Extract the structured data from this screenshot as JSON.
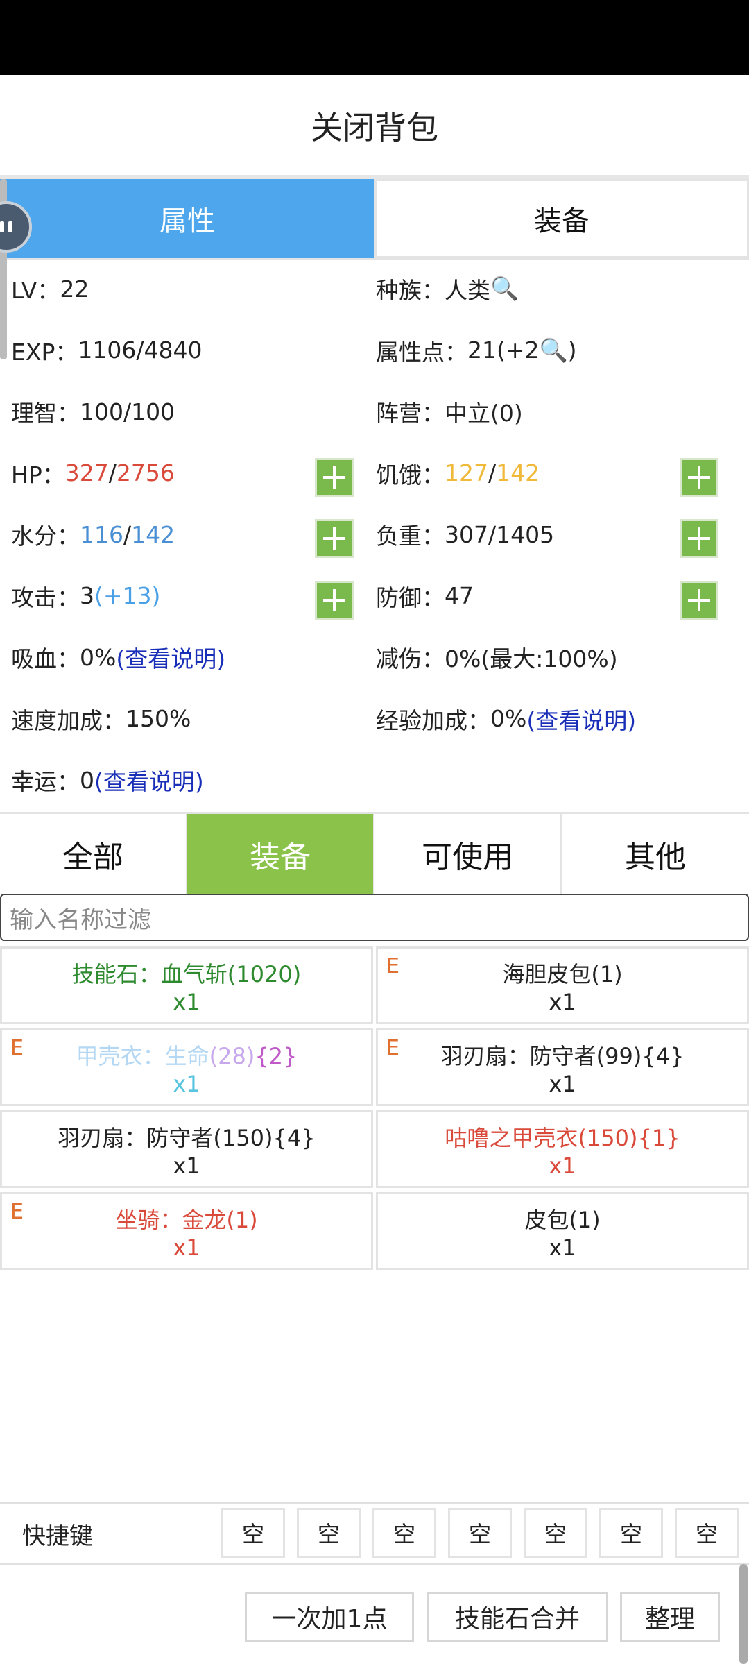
{
  "header": {
    "title": "关闭背包"
  },
  "main_tabs": [
    {
      "label": "属性",
      "active": true
    },
    {
      "label": "装备",
      "active": false
    }
  ],
  "attrs": {
    "lv_label": "LV：",
    "lv_value": "22",
    "race_label": "种族：",
    "race_value": "人类",
    "exp_label": "EXP：",
    "exp_value": "1106/4840",
    "points_label": "属性点：",
    "points_value": "21(+2",
    "points_close": ")",
    "sanity_label": "理智：",
    "sanity_value": "100/100",
    "camp_label": "阵营：",
    "camp_value": "中立(0)",
    "hp_label": "HP：",
    "hp_cur": "327",
    "hp_sep": "/",
    "hp_max": "2756",
    "hunger_label": "饥饿：",
    "hunger_cur": "127",
    "hunger_sep": "/",
    "hunger_max": "142",
    "water_label": "水分：",
    "water_cur": "116",
    "water_sep": "/",
    "water_max": "142",
    "load_label": "负重：",
    "load_value": "307/1405",
    "attack_label": "攻击：",
    "attack_value": "3",
    "attack_bonus": " (+13)",
    "defense_label": "防御：",
    "defense_value": "47",
    "lifesteal_label": "吸血：",
    "lifesteal_value": "0%",
    "lifesteal_link": "(查看说明)",
    "reduction_label": "减伤：",
    "reduction_value": "0%(最大:100%)",
    "speed_label": "速度加成：",
    "speed_value": "150%",
    "expbonus_label": "经验加成：",
    "expbonus_value": "0%",
    "expbonus_link": "(查看说明)",
    "luck_label": "幸运：",
    "luck_value": "0",
    "luck_link": "(查看说明)"
  },
  "category_tabs": [
    {
      "label": "全部",
      "active": false
    },
    {
      "label": "装备",
      "active": true
    },
    {
      "label": "可使用",
      "active": false
    },
    {
      "label": "其他",
      "active": false
    }
  ],
  "filter": {
    "placeholder": "输入名称过滤"
  },
  "items": [
    {
      "equipped": false,
      "name": "技能石：血气斩(1020)",
      "qty": "x1",
      "color": "#2e8a2e"
    },
    {
      "equipped": true,
      "name": "海胆皮包(1)",
      "qty": "x1",
      "color": "#222222"
    },
    {
      "equipped": true,
      "name_a": "甲壳衣：生命",
      "name_b": "(28)",
      "name_c": "{2}",
      "qty": "x1",
      "color": "#b4d8f4"
    },
    {
      "equipped": true,
      "name": "羽刃扇：防守者(99){4}",
      "qty": "x1",
      "color": "#222222"
    },
    {
      "equipped": false,
      "name": "羽刃扇：防守者(150){4}",
      "qty": "x1",
      "color": "#222222"
    },
    {
      "equipped": false,
      "name": "咕噜之甲壳衣(150){1}",
      "qty": "x1",
      "color": "#d94a3a"
    },
    {
      "equipped": true,
      "name": "坐骑：金龙(1)",
      "qty": "x1",
      "color": "#d94a3a"
    },
    {
      "equipped": false,
      "name": "皮包(1)",
      "qty": "x1",
      "color": "#222222"
    }
  ],
  "equip_marker": "E",
  "shortcut": {
    "label": "快捷键",
    "slots": [
      "空",
      "空",
      "空",
      "空",
      "空",
      "空",
      "空"
    ]
  },
  "actions": {
    "add_one": "一次加1点",
    "merge_stones": "技能石合并",
    "sort": "整理"
  }
}
